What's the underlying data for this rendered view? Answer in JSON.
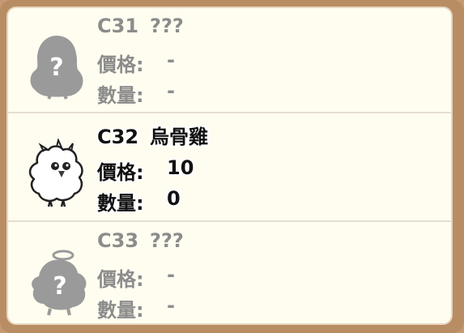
{
  "items": [
    {
      "code": "C31",
      "name": "???",
      "price_label": "價格:",
      "price_value": "-",
      "qty_label": "數量:",
      "qty_value": "-",
      "icon": "locked-silhouette-question-icon"
    },
    {
      "code": "C32",
      "name": "烏骨雞",
      "price_label": "價格:",
      "price_value": "10",
      "qty_label": "數量:",
      "qty_value": "0",
      "icon": "silkie-chicken-icon"
    },
    {
      "code": "C33",
      "name": "???",
      "price_label": "價格:",
      "price_value": "-",
      "qty_label": "數量:",
      "qty_value": "-",
      "icon": "locked-silhouette-question-icon"
    }
  ],
  "colors": {
    "frame": "#b98d63",
    "panel_bg": "#fffdf0",
    "locked_text": "#8c8c8c",
    "silhouette": "#9a9a9a",
    "unlocked_text": "#111111"
  }
}
